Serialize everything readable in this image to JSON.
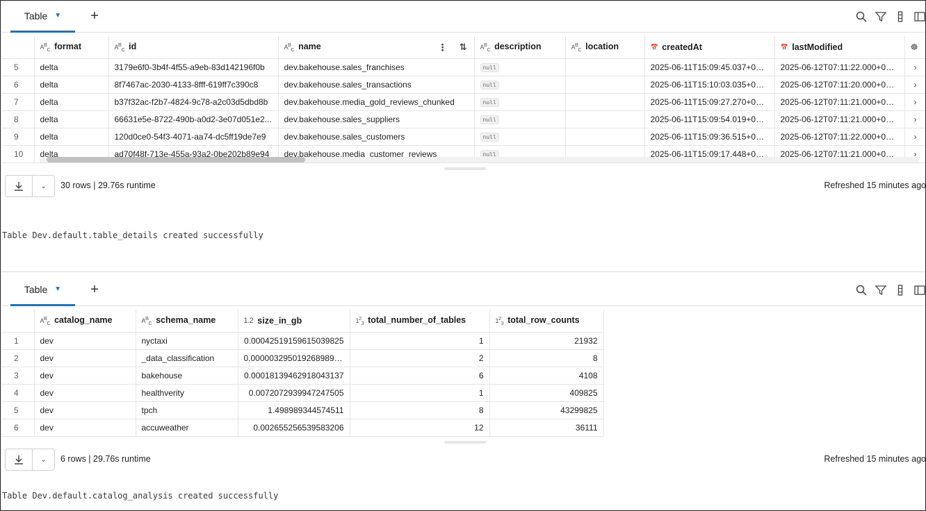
{
  "colors": {
    "accent": "#2272b4",
    "border": "#e5e5e5"
  },
  "icons": [
    "search-icon",
    "filter-icon",
    "column-icon",
    "sidebar-icon",
    "download-icon",
    "chevron-down-icon",
    "plus-icon",
    "row-expand-icon"
  ],
  "top": {
    "tab_label": "Table",
    "columns": [
      {
        "label": "format",
        "type": "ABC"
      },
      {
        "label": "id",
        "type": "ABC"
      },
      {
        "label": "name",
        "type": "ABC"
      },
      {
        "label": "description",
        "type": "ABC"
      },
      {
        "label": "location",
        "type": "ABC"
      },
      {
        "label": "createdAt",
        "type": "date"
      },
      {
        "label": "lastModified",
        "type": "date"
      }
    ],
    "rows": [
      {
        "idx": "5",
        "format": "delta",
        "id": "3179e6f0-3b4f-4f55-a9eb-83d142196f0b",
        "name": "dev.bakehouse.sales_franchises",
        "description": "null",
        "location": "",
        "createdAt": "2025-06-11T15:09:45.037+00:...",
        "lastModified": "2025-06-12T07:11:22.000+00:..."
      },
      {
        "idx": "6",
        "format": "delta",
        "id": "8f7467ac-2030-4133-8fff-619ff7c390c8",
        "name": "dev.bakehouse.sales_transactions",
        "description": "null",
        "location": "",
        "createdAt": "2025-06-11T15:10:03.035+00:...",
        "lastModified": "2025-06-12T07:11:20.000+00:..."
      },
      {
        "idx": "7",
        "format": "delta",
        "id": "b37f32ac-f2b7-4824-9c78-a2c03d5dbd8b",
        "name": "dev.bakehouse.media_gold_reviews_chunked",
        "description": "null",
        "location": "",
        "createdAt": "2025-06-11T15:09:27.270+00:...",
        "lastModified": "2025-06-12T07:11:21.000+00:..."
      },
      {
        "idx": "8",
        "format": "delta",
        "id": "66631e5e-8722-490b-a0d2-3e07d051e2...",
        "name": "dev.bakehouse.sales_suppliers",
        "description": "null",
        "location": "",
        "createdAt": "2025-06-11T15:09:54.019+00:...",
        "lastModified": "2025-06-12T07:11:21.000+00:..."
      },
      {
        "idx": "9",
        "format": "delta",
        "id": "120d0ce0-54f3-4071-aa74-dc5ff19de7e9",
        "name": "dev.bakehouse.sales_customers",
        "description": "null",
        "location": "",
        "createdAt": "2025-06-11T15:09:36.515+00:...",
        "lastModified": "2025-06-12T07:11:22.000+00:..."
      },
      {
        "idx": "10",
        "format": "delta",
        "id": "ad70f48f-713e-455a-93a2-0be202b89e94",
        "name": "dev.bakehouse.media_customer_reviews",
        "description": "null",
        "location": "",
        "createdAt": "2025-06-11T15:09:17.448+00:...",
        "lastModified": "2025-06-12T07:11:21.000+00:..."
      }
    ],
    "rows_info": "30 rows  |  29.76s runtime",
    "refreshed": "Refreshed 15 minutes ago",
    "console": "Table Dev.default.table_details created successfully"
  },
  "bottom": {
    "tab_label": "Table",
    "columns": [
      {
        "label": "catalog_name",
        "type": "ABC"
      },
      {
        "label": "schema_name",
        "type": "ABC"
      },
      {
        "label": "size_in_gb",
        "type": "1.2"
      },
      {
        "label": "total_number_of_tables",
        "type": "123"
      },
      {
        "label": "total_row_counts",
        "type": "123"
      }
    ],
    "rows": [
      {
        "idx": "1",
        "catalog_name": "dev",
        "schema_name": "nyctaxi",
        "size_in_gb": "0.00042519159615039825",
        "total_number_of_tables": "1",
        "total_row_counts": "21932"
      },
      {
        "idx": "2",
        "catalog_name": "dev",
        "schema_name": "_data_classification",
        "size_in_gb": "0.0000032950192689895...",
        "total_number_of_tables": "2",
        "total_row_counts": "8"
      },
      {
        "idx": "3",
        "catalog_name": "dev",
        "schema_name": "bakehouse",
        "size_in_gb": "0.00018139462918043137",
        "total_number_of_tables": "6",
        "total_row_counts": "4108"
      },
      {
        "idx": "4",
        "catalog_name": "dev",
        "schema_name": "healthverity",
        "size_in_gb": "0.0072072939947247505",
        "total_number_of_tables": "1",
        "total_row_counts": "409825"
      },
      {
        "idx": "5",
        "catalog_name": "dev",
        "schema_name": "tpch",
        "size_in_gb": "1.498989344574511",
        "total_number_of_tables": "8",
        "total_row_counts": "43299825"
      },
      {
        "idx": "6",
        "catalog_name": "dev",
        "schema_name": "accuweather",
        "size_in_gb": "0.002655256539583206",
        "total_number_of_tables": "12",
        "total_row_counts": "36111"
      }
    ],
    "rows_info": "6 rows  |  29.76s runtime",
    "refreshed": "Refreshed 15 minutes ago",
    "console": "Table Dev.default.catalog_analysis created successfully"
  }
}
